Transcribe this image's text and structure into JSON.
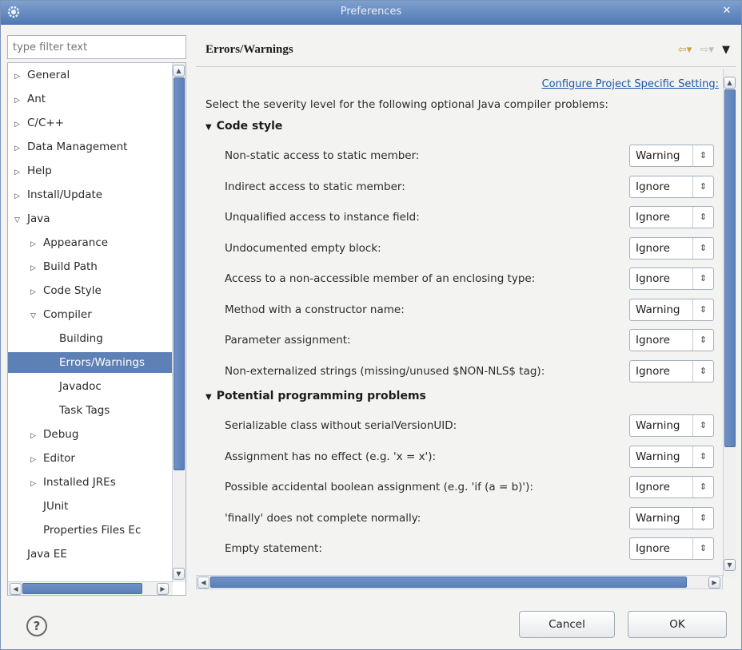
{
  "window": {
    "title": "Preferences",
    "app_icon": "eclipse-gear-icon",
    "close_icon": "close-icon"
  },
  "left": {
    "filter_placeholder": "type filter text",
    "tree": [
      {
        "label": "General",
        "level": 0,
        "arrow": "collapsed"
      },
      {
        "label": "Ant",
        "level": 0,
        "arrow": "collapsed"
      },
      {
        "label": "C/C++",
        "level": 0,
        "arrow": "collapsed"
      },
      {
        "label": "Data Management",
        "level": 0,
        "arrow": "collapsed"
      },
      {
        "label": "Help",
        "level": 0,
        "arrow": "collapsed"
      },
      {
        "label": "Install/Update",
        "level": 0,
        "arrow": "collapsed"
      },
      {
        "label": "Java",
        "level": 0,
        "arrow": "expanded"
      },
      {
        "label": "Appearance",
        "level": 1,
        "arrow": "collapsed"
      },
      {
        "label": "Build Path",
        "level": 1,
        "arrow": "collapsed"
      },
      {
        "label": "Code Style",
        "level": 1,
        "arrow": "collapsed"
      },
      {
        "label": "Compiler",
        "level": 1,
        "arrow": "expanded"
      },
      {
        "label": "Building",
        "level": 2,
        "arrow": "none"
      },
      {
        "label": "Errors/Warnings",
        "level": 2,
        "arrow": "none",
        "selected": true
      },
      {
        "label": "Javadoc",
        "level": 2,
        "arrow": "none"
      },
      {
        "label": "Task Tags",
        "level": 2,
        "arrow": "none"
      },
      {
        "label": "Debug",
        "level": 1,
        "arrow": "collapsed"
      },
      {
        "label": "Editor",
        "level": 1,
        "arrow": "collapsed"
      },
      {
        "label": "Installed JREs",
        "level": 1,
        "arrow": "collapsed"
      },
      {
        "label": "JUnit",
        "level": 1,
        "arrow": "none"
      },
      {
        "label": "Properties Files Ec",
        "level": 1,
        "arrow": "none"
      },
      {
        "label": "Java EE",
        "level": 0,
        "arrow": "none"
      }
    ]
  },
  "right": {
    "title": "Errors/Warnings",
    "config_link": "Configure Project Specific Setting:",
    "intro": "Select the severity level for the following optional Java compiler problems:",
    "sections": [
      {
        "title": "Code style",
        "options": [
          {
            "label": "Non-static access to static member:",
            "value": "Warning"
          },
          {
            "label": "Indirect access to static member:",
            "value": "Ignore"
          },
          {
            "label": "Unqualified access to instance field:",
            "value": "Ignore"
          },
          {
            "label": "Undocumented empty block:",
            "value": "Ignore"
          },
          {
            "label": "Access to a non-accessible member of an enclosing type:",
            "value": "Ignore"
          },
          {
            "label": "Method with a constructor name:",
            "value": "Warning"
          },
          {
            "label": "Parameter assignment:",
            "value": "Ignore"
          },
          {
            "label": "Non-externalized strings (missing/unused $NON-NLS$ tag):",
            "value": "Ignore"
          }
        ]
      },
      {
        "title": "Potential programming problems",
        "options": [
          {
            "label": "Serializable class without serialVersionUID:",
            "value": "Warning"
          },
          {
            "label": "Assignment has no effect (e.g. 'x = x'):",
            "value": "Warning"
          },
          {
            "label": "Possible accidental boolean assignment (e.g. 'if (a = b)'):",
            "value": "Ignore"
          },
          {
            "label": "'finally' does not complete normally:",
            "value": "Warning"
          },
          {
            "label": "Empty statement:",
            "value": "Ignore"
          }
        ]
      }
    ]
  },
  "buttons": {
    "help_icon": "help-question-icon",
    "cancel": "Cancel",
    "ok": "OK"
  },
  "colors": {
    "selection": "#5d80b5",
    "scroll_thumb": "#6588be",
    "link": "#1a56a8",
    "titlebar": "#5b82bc"
  }
}
